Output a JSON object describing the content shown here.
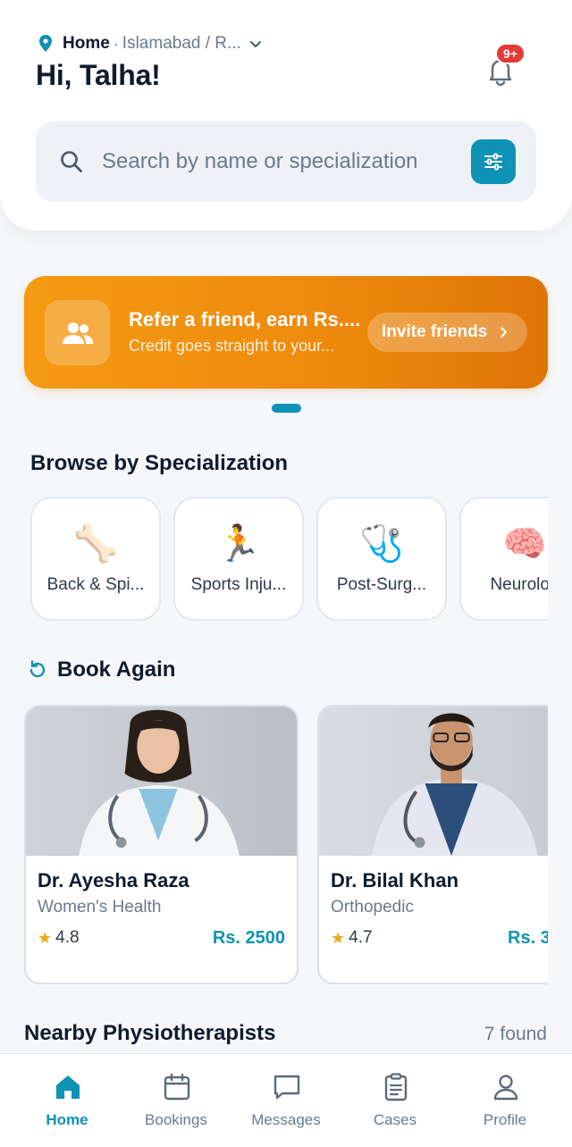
{
  "header": {
    "location_label": "Home",
    "location_separator": "·",
    "location_city": "Islamabad / R...",
    "greeting": "Hi, Talha!",
    "notification_badge": "9+"
  },
  "search": {
    "placeholder": "Search by name or specialization",
    "value": ""
  },
  "promo": {
    "title": "Refer a friend, earn Rs....",
    "subtitle": "Credit goes straight to your...",
    "button_label": "Invite friends"
  },
  "specialization": {
    "title": "Browse by Specialization",
    "items": [
      {
        "label": "Back & Spi...",
        "icon": "bone-icon",
        "emoji": "🦴"
      },
      {
        "label": "Sports Inju...",
        "icon": "runner-icon",
        "emoji": "🏃"
      },
      {
        "label": "Post-Surg...",
        "icon": "stethoscope-icon",
        "emoji": "🩺"
      },
      {
        "label": "Neurolog",
        "icon": "brain-icon",
        "emoji": "🧠"
      }
    ]
  },
  "book_again": {
    "title": "Book Again",
    "doctors": [
      {
        "name": "Dr. Ayesha Raza",
        "specialty": "Women's Health",
        "rating": "4.8",
        "price": "Rs. 2500"
      },
      {
        "name": "Dr. Bilal Khan",
        "specialty": "Orthopedic",
        "rating": "4.7",
        "price": "Rs. 3"
      }
    ]
  },
  "nearby": {
    "title": "Nearby Physiotherapists",
    "count": "7 found"
  },
  "nav": {
    "items": [
      {
        "label": "Home",
        "icon": "home-icon",
        "active": true
      },
      {
        "label": "Bookings",
        "icon": "calendar-icon",
        "active": false
      },
      {
        "label": "Messages",
        "icon": "chat-icon",
        "active": false
      },
      {
        "label": "Cases",
        "icon": "clipboard-icon",
        "active": false
      },
      {
        "label": "Profile",
        "icon": "user-icon",
        "active": false
      }
    ]
  },
  "colors": {
    "accent": "#0e92b6",
    "promo_start": "#f59a12",
    "promo_end": "#e07406",
    "badge": "#e53935",
    "star": "#f0a41a"
  }
}
